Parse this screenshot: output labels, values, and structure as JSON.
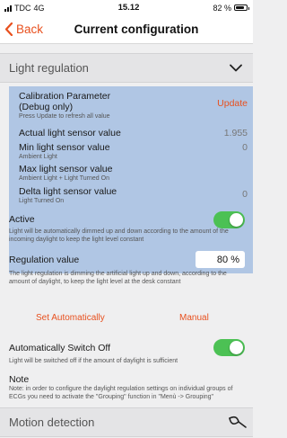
{
  "status": {
    "carrier": "TDC",
    "network": "4G",
    "time": "15.12",
    "battery": "82 %",
    "battery_level": 0.82
  },
  "nav": {
    "back_label": "Back",
    "title": "Current configuration"
  },
  "light_regulation": {
    "title": "Light regulation",
    "calibration": {
      "label_line1": "Calibration Parameter",
      "label_line2": "(Debug only)",
      "action": "Update",
      "hint": "Press Update to refresh all value"
    },
    "actual": {
      "label": "Actual light sensor value",
      "value": "1.955"
    },
    "min": {
      "label": "Min light sensor value",
      "value": "0",
      "sub": "Ambient Light"
    },
    "max": {
      "label": "Max light sensor value",
      "sub": "Ambient Light + Light Turned On"
    },
    "delta": {
      "label": "Delta light sensor value",
      "value": "0",
      "sub": "Light Turned On"
    },
    "active": {
      "label": "Active",
      "on": true,
      "description": "Light will be automatically dimmed up and down according to the amount of the incoming daylight to keep the light level constant"
    },
    "regulation": {
      "label": "Regulation value",
      "value": "80 %",
      "description": "The light regulation is dimming the artificial light up and down, according to the amount of daylight, to keep the light level at the desk constant"
    },
    "set_automatically": "Set Automatically",
    "manual": "Manual",
    "auto_off": {
      "label": "Automatically Switch Off",
      "on": true,
      "description": "Light will be switched off if the amount of daylight is sufficient"
    },
    "note": {
      "title": "Note",
      "text": "Note: in order to configure the daylight regulation settings on individual groups of ECGs you need to activate the \"Grouping\" function in \"Menù -> Grouping\""
    }
  },
  "motion_detection": {
    "title": "Motion detection"
  }
}
